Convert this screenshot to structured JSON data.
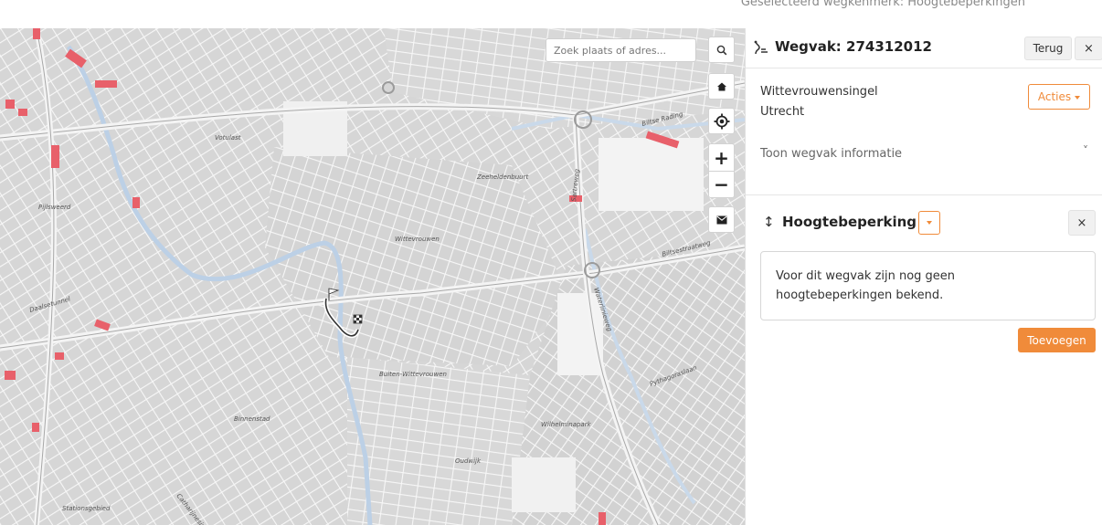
{
  "topbar": {
    "selected_marker": "Geselecteerd wegkenmerk: Hoogtebeperkingen"
  },
  "map": {
    "search_placeholder": "Zoek plaats of adres...",
    "labels": {
      "votulast": "Votulast",
      "zeeheldenbuurt": "Zeeheldenbuurt",
      "pijlsweerd": "Pijlsweerd",
      "wittevrouwen": "Wittevrouwen",
      "sartreweg": "Sartreweg",
      "biltse_rading": "Biltse Rading",
      "biltse_straatweg": "Biltsestraatweg",
      "daalseturmel": "Daalsetunnel",
      "buiten_wittevrouwen": "Buiten-Wittevrouwen",
      "binnenstad": "Binnenstad",
      "wilhelminapark": "Wilhelminapark",
      "oudwijk": "Oudwijk",
      "stationsgebied": "Stationsgebied",
      "pythagoraslaan": "Pythagoraslaan",
      "waterlinieweg": "Waterlinieweg",
      "catharijnesingel": "Catharijnesingel"
    },
    "accent_color": "#f08b3a",
    "restriction_color": "#e8606a",
    "buttons": {
      "search": "search-icon",
      "home": "home-icon",
      "locate": "locate-icon",
      "zoom_in": "+",
      "zoom_out": "−",
      "mail": "mail-icon"
    }
  },
  "panel": {
    "title": "Wegvak: 274312012",
    "back_label": "Terug",
    "close_label": "×",
    "street": "Wittevrouwensingel",
    "city": "Utrecht",
    "actions_label": "Acties",
    "show_info_label": "Toon wegvak informatie",
    "chevron": "˅",
    "section": {
      "icon": "↕",
      "title": "Hoogtebeperking",
      "close_label": "×",
      "message_line1": "Voor dit wegvak zijn nog geen",
      "message_line2": "hoogtebeperkingen bekend.",
      "add_label": "Toevoegen"
    }
  }
}
